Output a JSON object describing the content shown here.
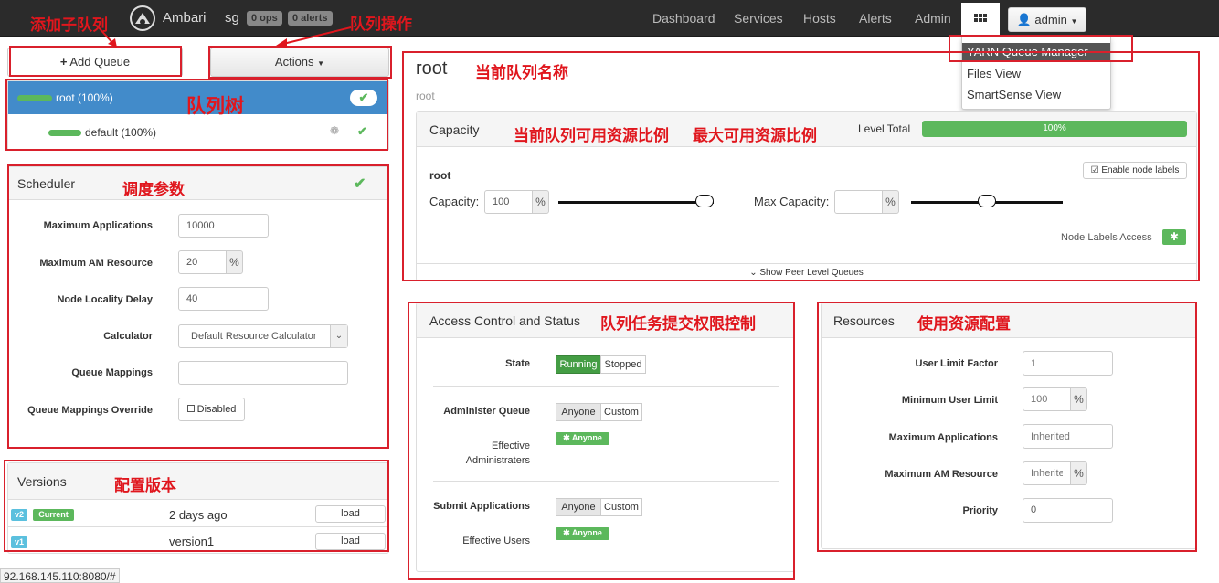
{
  "topbar": {
    "brand": "Ambari",
    "cluster": "sg",
    "ops_badge": "0 ops",
    "alerts_badge": "0 alerts",
    "nav": [
      "Dashboard",
      "Services",
      "Hosts",
      "Alerts",
      "Admin"
    ],
    "user": "admin"
  },
  "views_menu": {
    "items": [
      "YARN Queue Manager",
      "Files View",
      "SmartSense View"
    ]
  },
  "toolbar": {
    "add_queue": "Add Queue",
    "actions": "Actions"
  },
  "queue_tree": {
    "root": {
      "label": "root (100%)"
    },
    "default": {
      "label": "default (100%)"
    }
  },
  "scheduler": {
    "title": "Scheduler",
    "fields": {
      "max_apps": {
        "label": "Maximum Applications",
        "value": "10000"
      },
      "max_am": {
        "label": "Maximum AM Resource",
        "value": "20",
        "unit": "%"
      },
      "locality": {
        "label": "Node Locality Delay",
        "value": "40"
      },
      "calculator": {
        "label": "Calculator",
        "value": "Default Resource Calculator"
      },
      "mappings": {
        "label": "Queue Mappings",
        "value": ""
      },
      "override": {
        "label": "Queue Mappings Override",
        "value": "Disabled"
      }
    }
  },
  "versions": {
    "title": "Versions",
    "rows": [
      {
        "tag": "v2",
        "current": "Current",
        "when": "2 days ago",
        "button": "load"
      },
      {
        "tag": "v1",
        "current": "",
        "when": "version1",
        "button": "load"
      }
    ]
  },
  "queue": {
    "name": "root",
    "path": "root",
    "capacity_panel": {
      "title": "Capacity",
      "level_total_label": "Level Total",
      "level_total_value": "100%",
      "level_total_fraction": 1.0,
      "enable_labels": "Enable node labels",
      "row_name": "root",
      "capacity_label": "Capacity:",
      "capacity_value": "100",
      "capacity_unit": "%",
      "max_capacity_label": "Max Capacity:",
      "max_capacity_value": "",
      "max_capacity_unit": "%",
      "capacity_slider": 1.0,
      "max_capacity_slider": 0.5,
      "node_labels_access": "Node Labels Access",
      "show_peer": "Show Peer Level Queues"
    },
    "access_panel": {
      "title": "Access Control and Status",
      "state_label": "State",
      "state_options": [
        "Running",
        "Stopped"
      ],
      "administer_label": "Administer Queue",
      "administer_options": [
        "Anyone",
        "Custom"
      ],
      "effective_admins_label_1": "Effective",
      "effective_admins_label_2": "Administraters",
      "effective_admins_tag": "Anyone",
      "submit_label": "Submit Applications",
      "submit_options": [
        "Anyone",
        "Custom"
      ],
      "effective_users_label": "Effective Users",
      "effective_users_tag": "Anyone"
    },
    "resources_panel": {
      "title": "Resources",
      "user_limit": {
        "label": "User Limit Factor",
        "placeholder": "1"
      },
      "min_user": {
        "label": "Minimum User Limit",
        "placeholder": "100",
        "unit": "%"
      },
      "max_apps": {
        "label": "Maximum Applications",
        "placeholder": "Inherited"
      },
      "max_am": {
        "label": "Maximum AM Resource",
        "placeholder": "Inherite",
        "unit": "%"
      },
      "priority": {
        "label": "Priority",
        "value": "0"
      }
    }
  },
  "annotations": {
    "add_child": "添加子队列",
    "queue_ops": "队列操作",
    "queue_tree": "队列树",
    "sched_params": "调度参数",
    "versions": "配置版本",
    "current_name": "当前队列名称",
    "available_ratio": "当前队列可用资源比例",
    "max_ratio": "最大可用资源比例",
    "submit_acl": "队列任务提交权限控制",
    "resources": "使用资源配置"
  },
  "statusbar": {
    "url": "92.168.145.110:8080/#"
  },
  "colors": {
    "accent_blue": "#428bca",
    "success_green": "#5cb85c",
    "annotation_red": "#d9202c",
    "topbar": "#2b2b2b"
  }
}
